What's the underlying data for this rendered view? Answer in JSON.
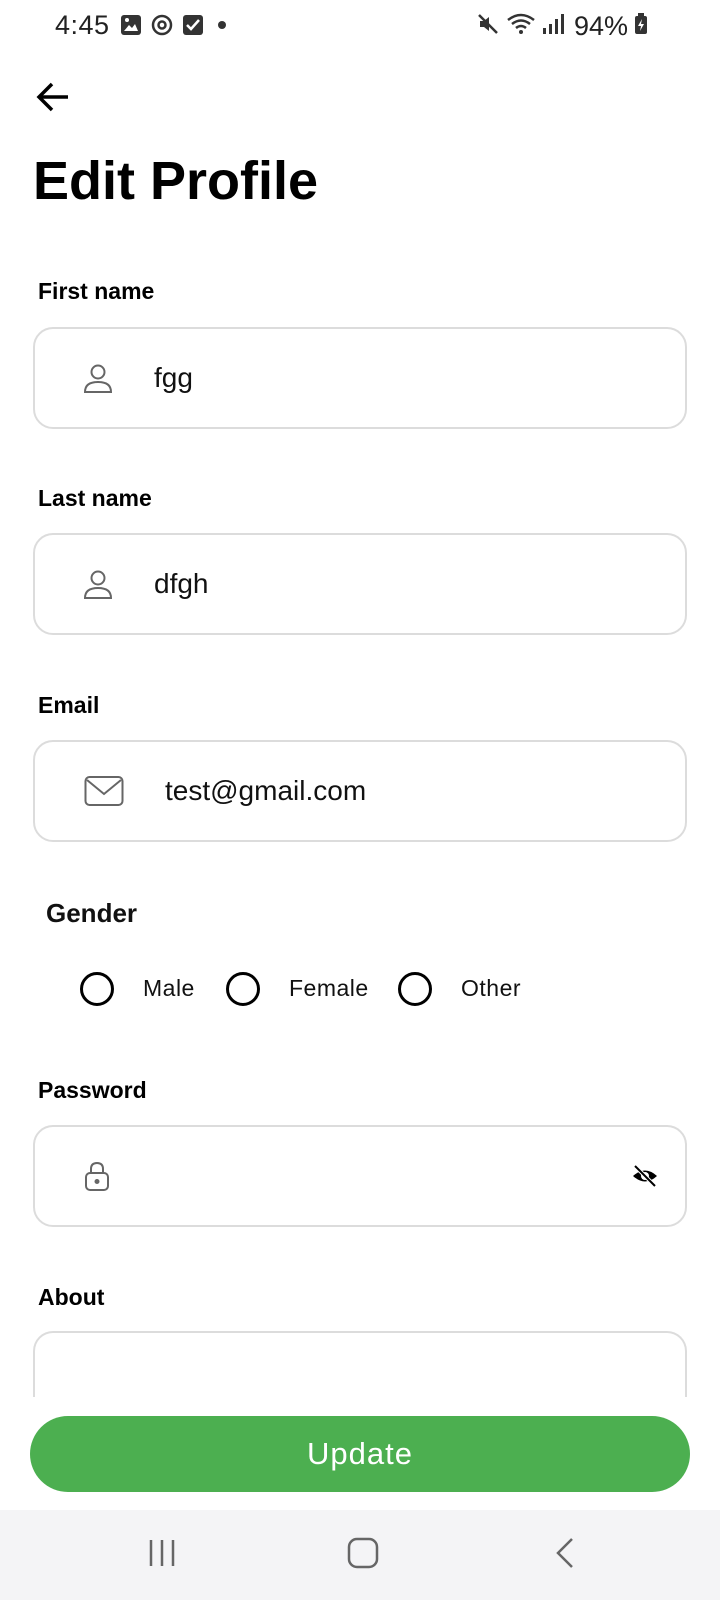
{
  "status_bar": {
    "time": "4:45",
    "battery": "94%",
    "left_icons": [
      "image-icon",
      "sync-icon",
      "checkbox-icon",
      "dot-icon"
    ],
    "right_icons": [
      "mute-icon",
      "wifi-icon",
      "signal-icon",
      "battery-icon"
    ]
  },
  "header": {
    "title": "Edit Profile"
  },
  "form": {
    "first_name": {
      "label": "First name",
      "value": "fgg"
    },
    "last_name": {
      "label": "Last name",
      "value": "dfgh"
    },
    "email": {
      "label": "Email",
      "value": "test@gmail.com"
    },
    "gender": {
      "label": "Gender",
      "options": [
        "Male",
        "Female",
        "Other"
      ]
    },
    "password": {
      "label": "Password",
      "value": ""
    },
    "about": {
      "label": "About",
      "value": ""
    }
  },
  "actions": {
    "update_label": "Update"
  },
  "colors": {
    "accent": "#4caf50",
    "border": "#dcdcdc",
    "nav_background": "#f4f4f6"
  }
}
